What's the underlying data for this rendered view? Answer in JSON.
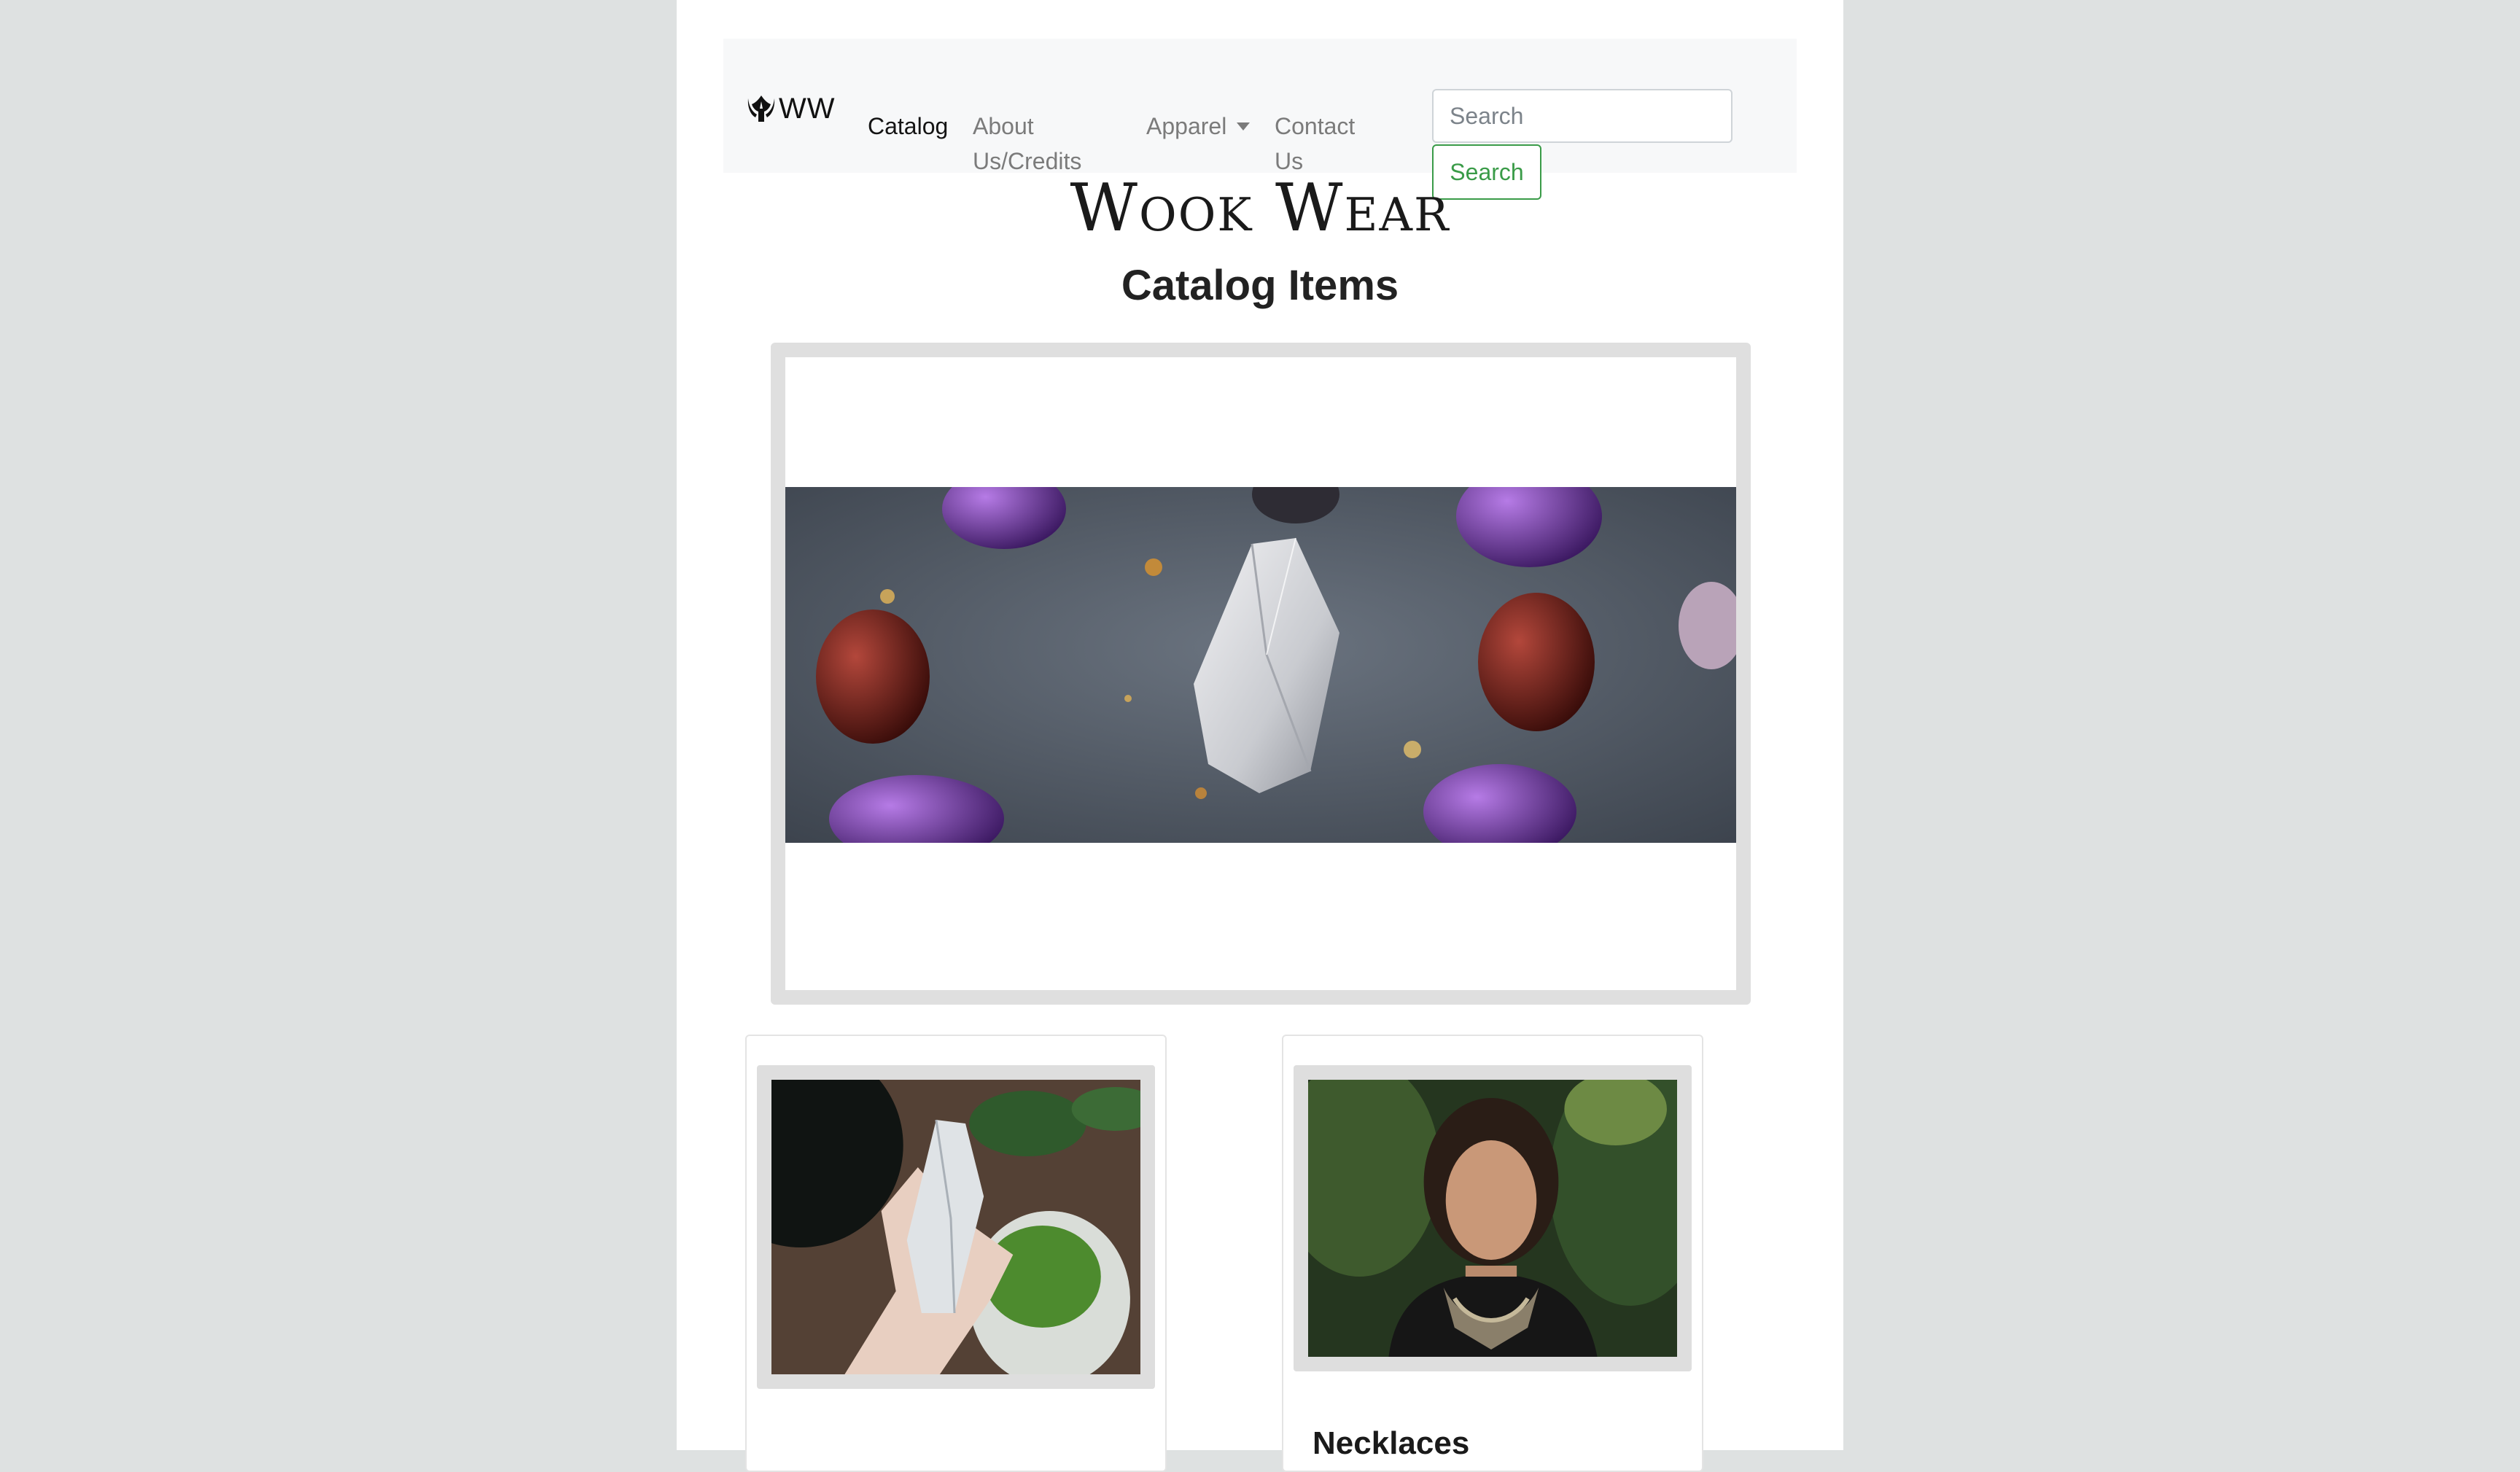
{
  "navbar": {
    "brand": "WW",
    "links": [
      {
        "label": "Catalog",
        "active": true
      },
      {
        "label": "About Us/Credits",
        "active": false
      },
      {
        "label": "Apparel",
        "active": false,
        "dropdown": true
      },
      {
        "label": "Contact Us",
        "active": false
      }
    ],
    "search": {
      "placeholder": "Search",
      "button_label": "Search"
    }
  },
  "header": {
    "site_title": "Wook Wear",
    "page_heading": "Catalog Items"
  },
  "cards": [
    {
      "title": ""
    },
    {
      "title": "Necklaces"
    }
  ],
  "colors": {
    "search_accent": "#3a9b48",
    "page_bg": "#dee1e1",
    "navbar_bg": "#f7f8f9"
  }
}
